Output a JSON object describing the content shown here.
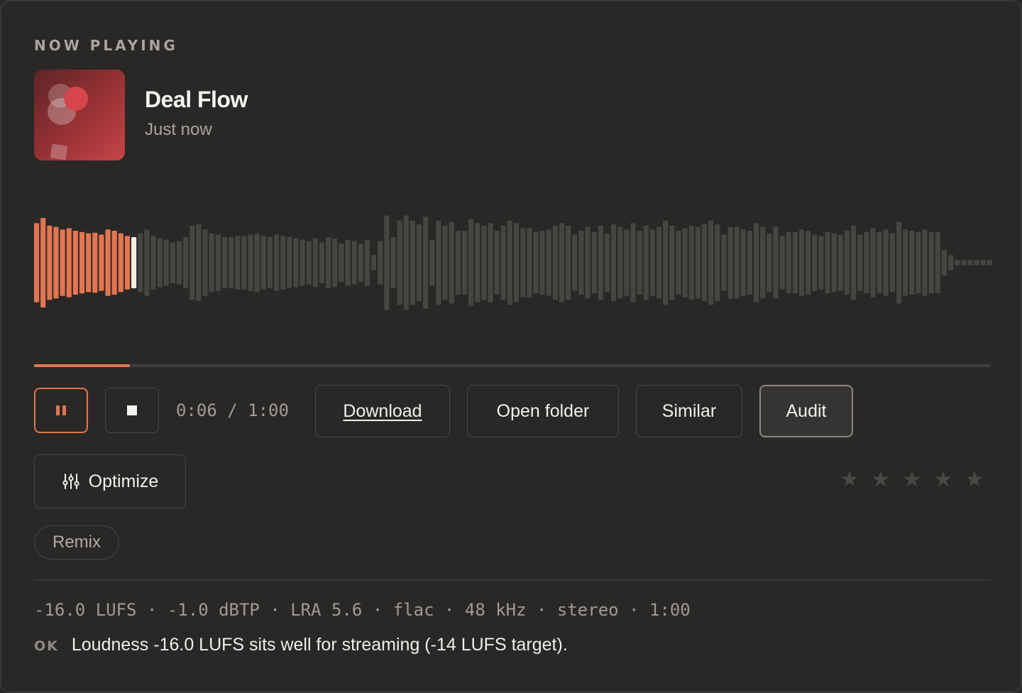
{
  "section_label": "NOW PLAYING",
  "track": {
    "title": "Deal Flow",
    "subtitle": "Just now"
  },
  "playback": {
    "elapsed": "0:06",
    "duration": "1:00",
    "time_display": "0:06 / 1:00",
    "progress": 0.1,
    "state": "playing"
  },
  "colors": {
    "accent": "#e47a52",
    "played": "#e27650",
    "unplayed": "#464541",
    "playhead": "#f4efe6"
  },
  "icons": {
    "pause": "pause-icon",
    "stop": "stop-icon",
    "optimize": "sliders-icon",
    "star": "star-icon"
  },
  "actions": {
    "download": "Download",
    "open_folder": "Open folder",
    "similar": "Similar",
    "audit": "Audit",
    "optimize": "Optimize"
  },
  "rating": {
    "value": 0,
    "max": 5,
    "glyph": "★"
  },
  "tags": [
    "Remix"
  ],
  "meta_line": "-16.0 LUFS · -1.0 dBTP · LRA 5.6 · flac · 48 kHz · stereo · 1:00",
  "status": {
    "tag": "OK",
    "message": "Loudness -16.0 LUFS sits well for streaming (-14 LUFS target)."
  },
  "waveform": {
    "played_fraction": 0.1,
    "levels": [
      0.62,
      0.7,
      0.58,
      0.56,
      0.52,
      0.54,
      0.5,
      0.48,
      0.46,
      0.47,
      0.44,
      0.52,
      0.5,
      0.46,
      0.42,
      0.4,
      0.46,
      0.52,
      0.42,
      0.38,
      0.36,
      0.32,
      0.34,
      0.4,
      0.58,
      0.6,
      0.52,
      0.46,
      0.44,
      0.4,
      0.4,
      0.42,
      0.42,
      0.44,
      0.46,
      0.42,
      0.4,
      0.44,
      0.42,
      0.4,
      0.38,
      0.36,
      0.34,
      0.38,
      0.32,
      0.4,
      0.38,
      0.3,
      0.36,
      0.34,
      0.3,
      0.36,
      0.12,
      0.34,
      0.74,
      0.4,
      0.66,
      0.74,
      0.66,
      0.6,
      0.72,
      0.36,
      0.66,
      0.58,
      0.64,
      0.5,
      0.5,
      0.68,
      0.62,
      0.58,
      0.62,
      0.5,
      0.58,
      0.66,
      0.62,
      0.54,
      0.54,
      0.48,
      0.5,
      0.52,
      0.58,
      0.62,
      0.58,
      0.44,
      0.5,
      0.56,
      0.48,
      0.58,
      0.46,
      0.6,
      0.56,
      0.52,
      0.62,
      0.5,
      0.58,
      0.52,
      0.56,
      0.66,
      0.58,
      0.5,
      0.54,
      0.58,
      0.56,
      0.6,
      0.66,
      0.6,
      0.44,
      0.56,
      0.56,
      0.52,
      0.5,
      0.62,
      0.56,
      0.46,
      0.56,
      0.42,
      0.48,
      0.48,
      0.52,
      0.5,
      0.44,
      0.42,
      0.48,
      0.46,
      0.44,
      0.5,
      0.58,
      0.44,
      0.48,
      0.54,
      0.48,
      0.52,
      0.46,
      0.64,
      0.52,
      0.5,
      0.48,
      0.52,
      0.48,
      0.48,
      0.2,
      0.12,
      0.04,
      0.04,
      0.04,
      0.04,
      0.04,
      0.04
    ]
  }
}
